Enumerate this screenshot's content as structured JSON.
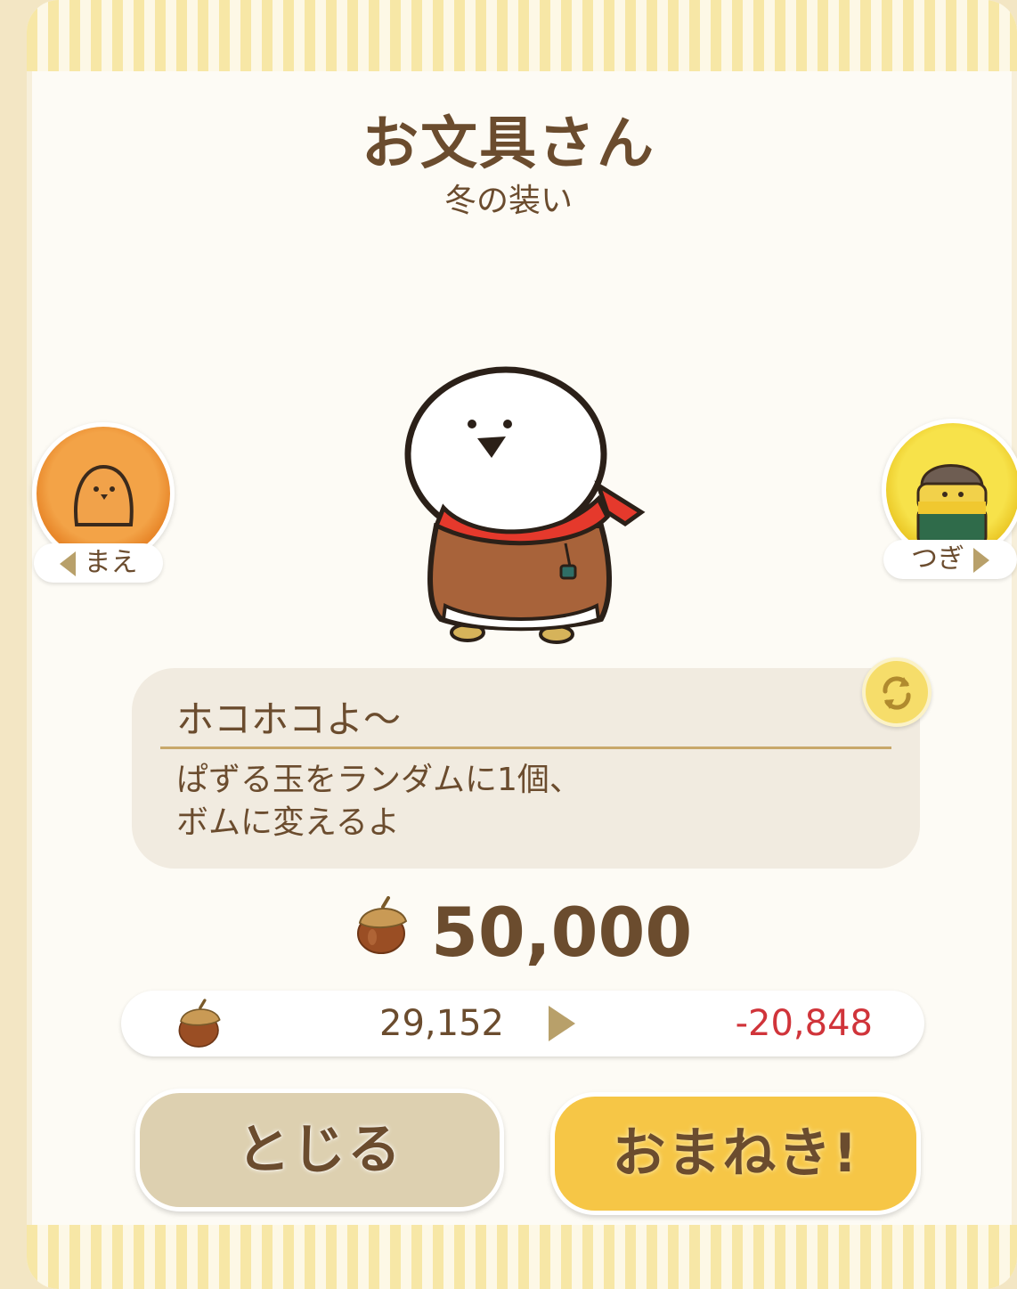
{
  "character": {
    "name": "お文具さん",
    "outfit": "冬の装い"
  },
  "nav": {
    "prev_label": "まえ",
    "next_label": "つぎ"
  },
  "speech": {
    "line": "ホコホコよ〜",
    "ability_line1": "ぱずる玉をランダムに1個、",
    "ability_line2": "ボムに変えるよ"
  },
  "cost": {
    "amount": "50,000",
    "currency_icon": "acorn-icon"
  },
  "balance": {
    "current": "29,152",
    "after": "-20,848",
    "after_color": "#d0343a"
  },
  "buttons": {
    "close": "とじる",
    "invite": "おまねき!"
  },
  "colors": {
    "text_brown": "#6b4c2e",
    "invite_yellow": "#f6c646",
    "close_beige": "#ddd0b0"
  }
}
